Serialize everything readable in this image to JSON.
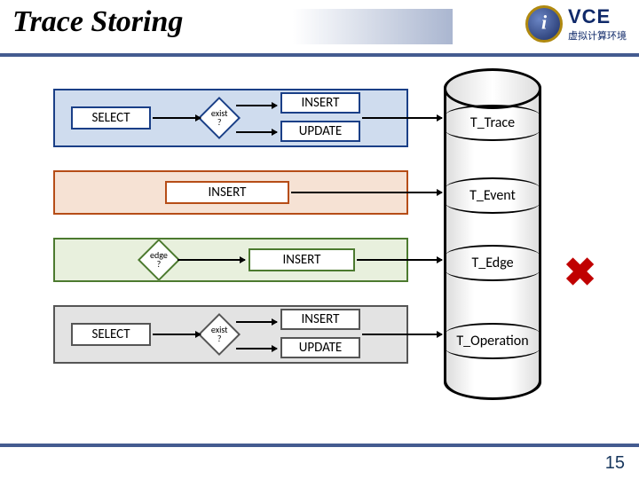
{
  "header": {
    "title": "Trace Storing",
    "logo_brand": "VCE",
    "logo_tagline": "虚拟计算环境"
  },
  "ops": {
    "select": "SELECT",
    "insert": "INSERT",
    "update": "UPDATE"
  },
  "decisions": {
    "exist": "exist\n?",
    "edge": "edge\n?"
  },
  "tables": {
    "trace": "T_Trace",
    "event": "T_Event",
    "edge": "T_Edge",
    "operation": "T_Operation"
  },
  "marks": {
    "x": "✖"
  },
  "page": {
    "num": "15"
  }
}
